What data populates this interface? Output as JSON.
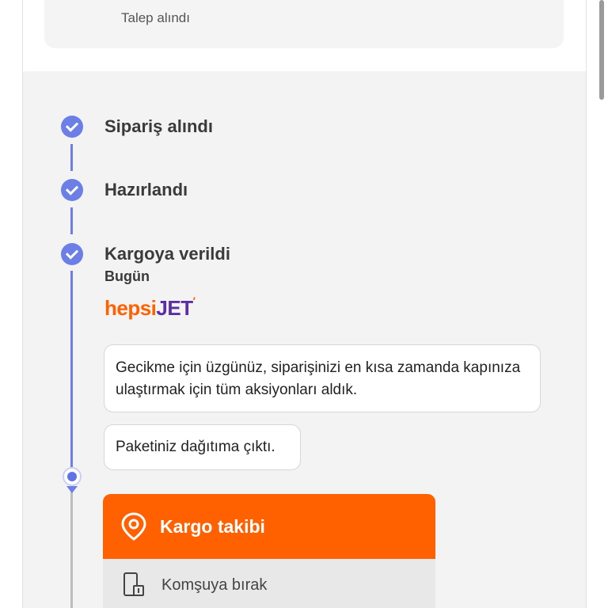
{
  "order_card": {
    "status": "Talep alındı"
  },
  "timeline": {
    "steps": [
      {
        "title": "Sipariş alındı"
      },
      {
        "title": "Hazırlandı"
      },
      {
        "title": "Kargoya verildi",
        "date": "Bugün"
      }
    ],
    "carrier": {
      "logo_part1": "hepsi",
      "logo_part2": "JET"
    },
    "messages": [
      "Gecikme için üzgünüz, siparişinizi en kısa zamanda kapınıza ulaştırmak için tüm aksiyonları aldık.",
      "Paketiniz dağıtıma çıktı."
    ]
  },
  "actions": {
    "track_label": "Kargo takibi",
    "neighbor_label": "Komşuya bırak"
  },
  "colors": {
    "accent": "#ff6000",
    "timeline": "#6b7fe6",
    "carrier_purple": "#5b2ea6"
  },
  "icons": [
    "chevron-right-icon",
    "check-icon",
    "location-pin-icon",
    "door-icon"
  ]
}
